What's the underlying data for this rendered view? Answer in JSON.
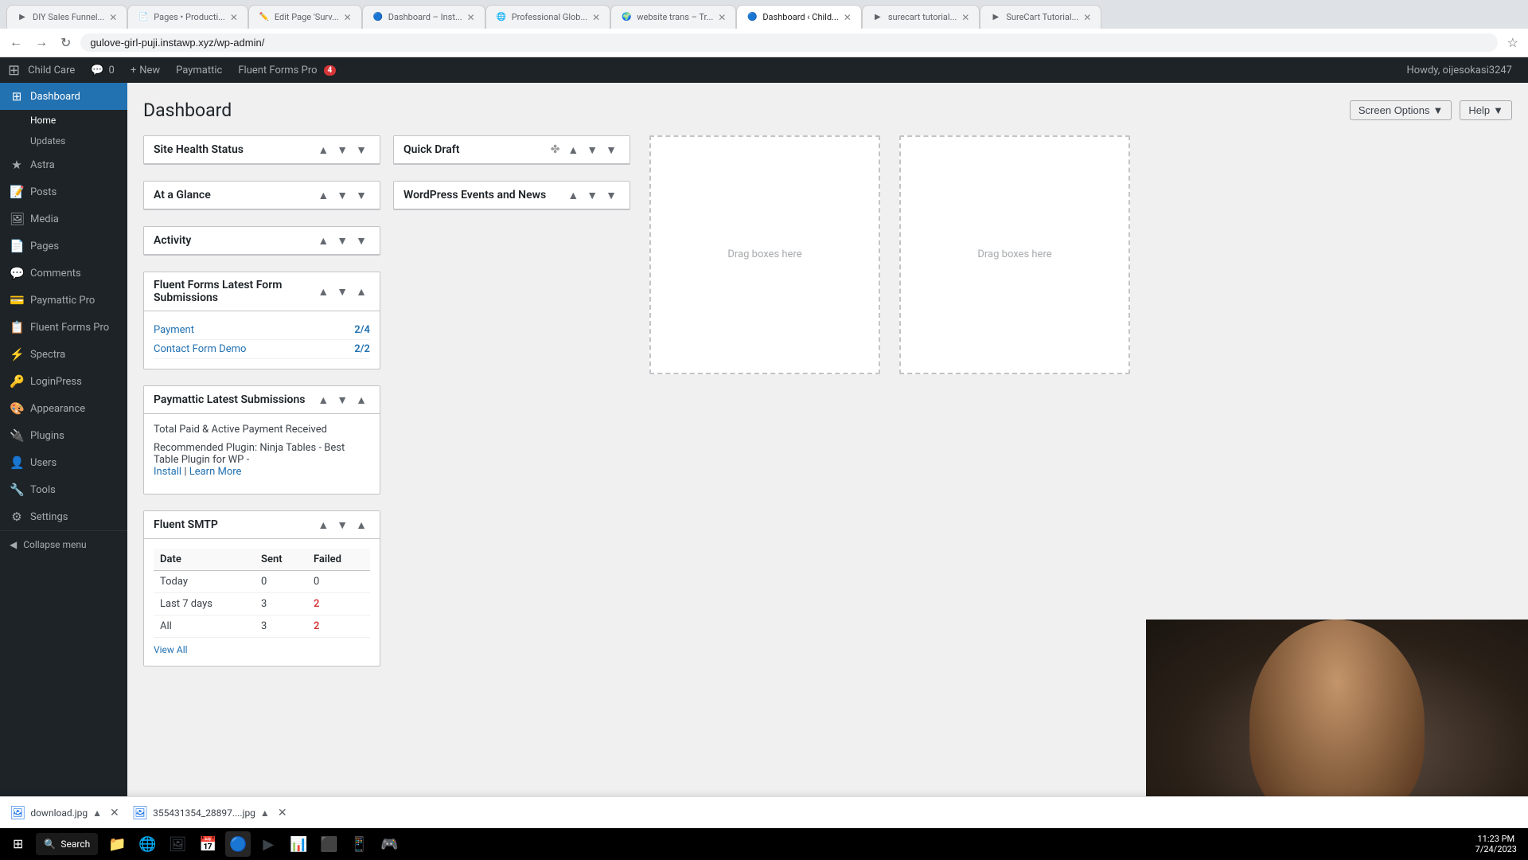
{
  "browser": {
    "address": "gulove-girl-puji.instawp.xyz/wp-admin/",
    "tabs": [
      {
        "id": "tab1",
        "favicon": "▶",
        "title": "DIY Sales Funnel...",
        "active": false
      },
      {
        "id": "tab2",
        "favicon": "📄",
        "title": "Pages • Producti...",
        "active": false
      },
      {
        "id": "tab3",
        "favicon": "✏️",
        "title": "Edit Page 'Surv...",
        "active": false
      },
      {
        "id": "tab4",
        "favicon": "🔵",
        "title": "Dashboard – Inst...",
        "active": false
      },
      {
        "id": "tab5",
        "favicon": "🌐",
        "title": "Professional Glob...",
        "active": false
      },
      {
        "id": "tab6",
        "favicon": "🌍",
        "title": "website trans – Tr...",
        "active": false
      },
      {
        "id": "tab7",
        "favicon": "🔵",
        "title": "Dashboard ‹ Child...",
        "active": true
      },
      {
        "id": "tab8",
        "favicon": "▶",
        "title": "surecart tutorial...",
        "active": false
      },
      {
        "id": "tab9",
        "favicon": "▶",
        "title": "SureCart Tutorial...",
        "active": false
      }
    ]
  },
  "adminbar": {
    "site_name": "Child Care",
    "comment_count": "0",
    "new_label": "New",
    "paymattic_label": "Paymattic",
    "fluent_forms_label": "Fluent Forms Pro",
    "fluent_forms_badge": "4",
    "howdy": "Howdy, oijesokasi3247",
    "screen_options": "Screen Options",
    "help": "Help"
  },
  "sidebar": {
    "items": [
      {
        "id": "dashboard",
        "icon": "⊞",
        "label": "Dashboard",
        "active": true
      },
      {
        "id": "home",
        "icon": "",
        "label": "Home",
        "sub": true
      },
      {
        "id": "updates",
        "icon": "",
        "label": "Updates",
        "sub": true
      },
      {
        "id": "astra",
        "icon": "★",
        "label": "Astra",
        "active": false
      },
      {
        "id": "posts",
        "icon": "📝",
        "label": "Posts",
        "active": false
      },
      {
        "id": "media",
        "icon": "🖼",
        "label": "Media",
        "active": false
      },
      {
        "id": "pages",
        "icon": "📄",
        "label": "Pages",
        "active": false
      },
      {
        "id": "comments",
        "icon": "💬",
        "label": "Comments",
        "active": false
      },
      {
        "id": "paymattic-pro",
        "icon": "💳",
        "label": "Paymattic Pro",
        "active": false
      },
      {
        "id": "fluent-forms-pro",
        "icon": "📋",
        "label": "Fluent Forms Pro",
        "active": false
      },
      {
        "id": "spectra",
        "icon": "⚡",
        "label": "Spectra",
        "active": false
      },
      {
        "id": "loginpress",
        "icon": "🔑",
        "label": "LoginPress",
        "active": false
      },
      {
        "id": "appearance",
        "icon": "🎨",
        "label": "Appearance",
        "active": false
      },
      {
        "id": "plugins",
        "icon": "🔌",
        "label": "Plugins",
        "active": false
      },
      {
        "id": "users",
        "icon": "👤",
        "label": "Users",
        "active": false
      },
      {
        "id": "tools",
        "icon": "🔧",
        "label": "Tools",
        "active": false
      },
      {
        "id": "settings",
        "icon": "⚙",
        "label": "Settings",
        "active": false
      }
    ],
    "collapse_label": "Collapse menu"
  },
  "page": {
    "title": "Dashboard",
    "screen_options_label": "Screen Options",
    "help_label": "Help"
  },
  "widgets": {
    "site_health": {
      "title": "Site Health Status",
      "controls": [
        "▲",
        "▼",
        "▼"
      ]
    },
    "quick_draft": {
      "title": "Quick Draft",
      "controls": [
        "▲",
        "▼",
        "▼"
      ]
    },
    "at_a_glance": {
      "title": "At a Glance",
      "controls": [
        "▲",
        "▼",
        "▼"
      ]
    },
    "wp_events": {
      "title": "WordPress Events and News",
      "controls": [
        "▲",
        "▼",
        "▼"
      ]
    },
    "activity": {
      "title": "Activity",
      "controls": [
        "▲",
        "▼",
        "▼"
      ]
    },
    "fluent_forms": {
      "title": "Fluent Forms Latest Form Submissions",
      "controls": [
        "▲",
        "▼",
        "▲"
      ],
      "forms": [
        {
          "name": "Payment",
          "count": "2/4"
        },
        {
          "name": "Contact Form Demo",
          "count": "2/2"
        }
      ]
    },
    "paymattic": {
      "title": "Paymattic Latest Submissions",
      "controls": [
        "▲",
        "▼",
        "▲"
      ],
      "total_label": "Total Paid & Active Payment Received",
      "plugin_recommendation": "Recommended Plugin: Ninja Tables - Best Table Plugin for WP -",
      "install_label": "Install",
      "learn_more_label": "Learn More"
    },
    "fluent_smtp": {
      "title": "Fluent SMTP",
      "controls": [
        "▲",
        "▼",
        "▲"
      ],
      "table": {
        "headers": [
          "Date",
          "Sent",
          "Failed"
        ],
        "rows": [
          {
            "date": "Today",
            "sent": "0",
            "failed": "0",
            "failed_red": false
          },
          {
            "date": "Last 7 days",
            "sent": "3",
            "failed": "2",
            "failed_red": true
          },
          {
            "date": "All",
            "sent": "3",
            "failed": "2",
            "failed_red": true
          }
        ]
      },
      "view_all_label": "View All"
    },
    "drag_box_1": "Drag boxes here",
    "drag_box_2": "Drag boxes here"
  },
  "downloads": [
    {
      "icon": "🖼",
      "filename": "download.jpg"
    },
    {
      "icon": "🖼",
      "filename": "355431354_28897....jpg"
    }
  ],
  "taskbar": {
    "search_placeholder": "Search",
    "time": "11:23 PM",
    "date": "7/24/2023"
  }
}
